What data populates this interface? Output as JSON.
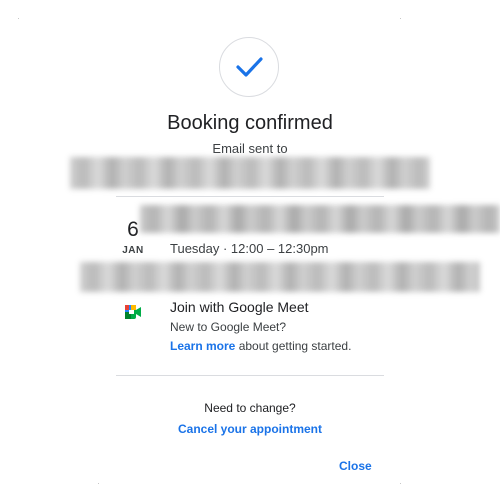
{
  "dialog": {
    "title": "Booking confirmed",
    "email_sent_label": "Email sent to",
    "event": {
      "day": "6",
      "month": "JAN",
      "time": "Tuesday · 12:00 – 12:30pm"
    },
    "meet": {
      "title": "Join with Google Meet",
      "new_text": "New to Google Meet?",
      "learn_more": "Learn more",
      "learn_suffix": " about getting started."
    },
    "change": {
      "prompt": "Need to change?",
      "cancel_label": "Cancel your appointment"
    },
    "close_label": "Close"
  },
  "colors": {
    "accent": "#1a73e8",
    "check": "#1a73e8",
    "divider": "#dadce0"
  },
  "icons": {
    "confirm": "checkmark-icon",
    "meet": "google-meet-icon"
  }
}
